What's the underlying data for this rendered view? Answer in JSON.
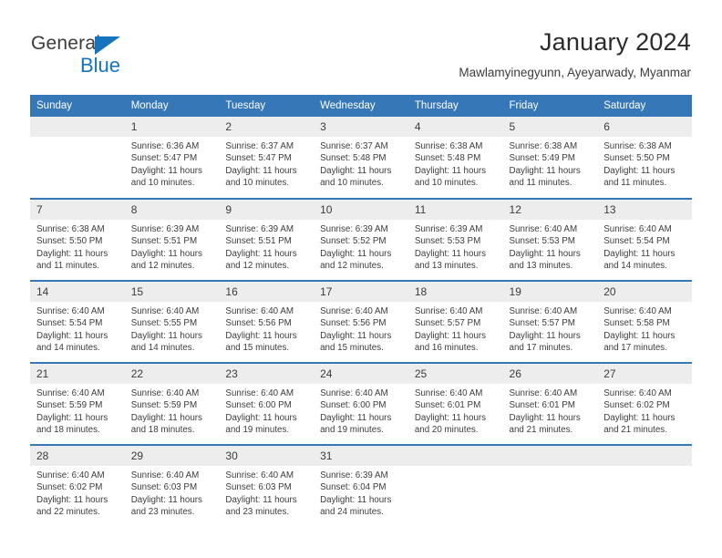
{
  "brand": {
    "name_part1": "General",
    "name_part2": "Blue",
    "triangle_icon": "blue-triangle-logo-mark",
    "accent_color": "#1574bb"
  },
  "header": {
    "title": "January 2024",
    "subtitle": "Mawlamyinegyunn, Ayeyarwady, Myanmar"
  },
  "theme": {
    "header_bar_color": "#3577b7",
    "daynum_band_color": "#ededed",
    "text_color": "#3c3c3c",
    "cell_background": "#ffffff"
  },
  "weekdays": [
    "Sunday",
    "Monday",
    "Tuesday",
    "Wednesday",
    "Thursday",
    "Friday",
    "Saturday"
  ],
  "weeks": [
    [
      {
        "day": "",
        "empty": true,
        "sunrise": "",
        "sunset": "",
        "daylight1": "",
        "daylight2": ""
      },
      {
        "day": "1",
        "sunrise": "Sunrise: 6:36 AM",
        "sunset": "Sunset: 5:47 PM",
        "daylight1": "Daylight: 11 hours",
        "daylight2": "and 10 minutes."
      },
      {
        "day": "2",
        "sunrise": "Sunrise: 6:37 AM",
        "sunset": "Sunset: 5:47 PM",
        "daylight1": "Daylight: 11 hours",
        "daylight2": "and 10 minutes."
      },
      {
        "day": "3",
        "sunrise": "Sunrise: 6:37 AM",
        "sunset": "Sunset: 5:48 PM",
        "daylight1": "Daylight: 11 hours",
        "daylight2": "and 10 minutes."
      },
      {
        "day": "4",
        "sunrise": "Sunrise: 6:38 AM",
        "sunset": "Sunset: 5:48 PM",
        "daylight1": "Daylight: 11 hours",
        "daylight2": "and 10 minutes."
      },
      {
        "day": "5",
        "sunrise": "Sunrise: 6:38 AM",
        "sunset": "Sunset: 5:49 PM",
        "daylight1": "Daylight: 11 hours",
        "daylight2": "and 11 minutes."
      },
      {
        "day": "6",
        "sunrise": "Sunrise: 6:38 AM",
        "sunset": "Sunset: 5:50 PM",
        "daylight1": "Daylight: 11 hours",
        "daylight2": "and 11 minutes."
      }
    ],
    [
      {
        "day": "7",
        "sunrise": "Sunrise: 6:38 AM",
        "sunset": "Sunset: 5:50 PM",
        "daylight1": "Daylight: 11 hours",
        "daylight2": "and 11 minutes."
      },
      {
        "day": "8",
        "sunrise": "Sunrise: 6:39 AM",
        "sunset": "Sunset: 5:51 PM",
        "daylight1": "Daylight: 11 hours",
        "daylight2": "and 12 minutes."
      },
      {
        "day": "9",
        "sunrise": "Sunrise: 6:39 AM",
        "sunset": "Sunset: 5:51 PM",
        "daylight1": "Daylight: 11 hours",
        "daylight2": "and 12 minutes."
      },
      {
        "day": "10",
        "sunrise": "Sunrise: 6:39 AM",
        "sunset": "Sunset: 5:52 PM",
        "daylight1": "Daylight: 11 hours",
        "daylight2": "and 12 minutes."
      },
      {
        "day": "11",
        "sunrise": "Sunrise: 6:39 AM",
        "sunset": "Sunset: 5:53 PM",
        "daylight1": "Daylight: 11 hours",
        "daylight2": "and 13 minutes."
      },
      {
        "day": "12",
        "sunrise": "Sunrise: 6:40 AM",
        "sunset": "Sunset: 5:53 PM",
        "daylight1": "Daylight: 11 hours",
        "daylight2": "and 13 minutes."
      },
      {
        "day": "13",
        "sunrise": "Sunrise: 6:40 AM",
        "sunset": "Sunset: 5:54 PM",
        "daylight1": "Daylight: 11 hours",
        "daylight2": "and 14 minutes."
      }
    ],
    [
      {
        "day": "14",
        "sunrise": "Sunrise: 6:40 AM",
        "sunset": "Sunset: 5:54 PM",
        "daylight1": "Daylight: 11 hours",
        "daylight2": "and 14 minutes."
      },
      {
        "day": "15",
        "sunrise": "Sunrise: 6:40 AM",
        "sunset": "Sunset: 5:55 PM",
        "daylight1": "Daylight: 11 hours",
        "daylight2": "and 14 minutes."
      },
      {
        "day": "16",
        "sunrise": "Sunrise: 6:40 AM",
        "sunset": "Sunset: 5:56 PM",
        "daylight1": "Daylight: 11 hours",
        "daylight2": "and 15 minutes."
      },
      {
        "day": "17",
        "sunrise": "Sunrise: 6:40 AM",
        "sunset": "Sunset: 5:56 PM",
        "daylight1": "Daylight: 11 hours",
        "daylight2": "and 15 minutes."
      },
      {
        "day": "18",
        "sunrise": "Sunrise: 6:40 AM",
        "sunset": "Sunset: 5:57 PM",
        "daylight1": "Daylight: 11 hours",
        "daylight2": "and 16 minutes."
      },
      {
        "day": "19",
        "sunrise": "Sunrise: 6:40 AM",
        "sunset": "Sunset: 5:57 PM",
        "daylight1": "Daylight: 11 hours",
        "daylight2": "and 17 minutes."
      },
      {
        "day": "20",
        "sunrise": "Sunrise: 6:40 AM",
        "sunset": "Sunset: 5:58 PM",
        "daylight1": "Daylight: 11 hours",
        "daylight2": "and 17 minutes."
      }
    ],
    [
      {
        "day": "21",
        "sunrise": "Sunrise: 6:40 AM",
        "sunset": "Sunset: 5:59 PM",
        "daylight1": "Daylight: 11 hours",
        "daylight2": "and 18 minutes."
      },
      {
        "day": "22",
        "sunrise": "Sunrise: 6:40 AM",
        "sunset": "Sunset: 5:59 PM",
        "daylight1": "Daylight: 11 hours",
        "daylight2": "and 18 minutes."
      },
      {
        "day": "23",
        "sunrise": "Sunrise: 6:40 AM",
        "sunset": "Sunset: 6:00 PM",
        "daylight1": "Daylight: 11 hours",
        "daylight2": "and 19 minutes."
      },
      {
        "day": "24",
        "sunrise": "Sunrise: 6:40 AM",
        "sunset": "Sunset: 6:00 PM",
        "daylight1": "Daylight: 11 hours",
        "daylight2": "and 19 minutes."
      },
      {
        "day": "25",
        "sunrise": "Sunrise: 6:40 AM",
        "sunset": "Sunset: 6:01 PM",
        "daylight1": "Daylight: 11 hours",
        "daylight2": "and 20 minutes."
      },
      {
        "day": "26",
        "sunrise": "Sunrise: 6:40 AM",
        "sunset": "Sunset: 6:01 PM",
        "daylight1": "Daylight: 11 hours",
        "daylight2": "and 21 minutes."
      },
      {
        "day": "27",
        "sunrise": "Sunrise: 6:40 AM",
        "sunset": "Sunset: 6:02 PM",
        "daylight1": "Daylight: 11 hours",
        "daylight2": "and 21 minutes."
      }
    ],
    [
      {
        "day": "28",
        "sunrise": "Sunrise: 6:40 AM",
        "sunset": "Sunset: 6:02 PM",
        "daylight1": "Daylight: 11 hours",
        "daylight2": "and 22 minutes."
      },
      {
        "day": "29",
        "sunrise": "Sunrise: 6:40 AM",
        "sunset": "Sunset: 6:03 PM",
        "daylight1": "Daylight: 11 hours",
        "daylight2": "and 23 minutes."
      },
      {
        "day": "30",
        "sunrise": "Sunrise: 6:40 AM",
        "sunset": "Sunset: 6:03 PM",
        "daylight1": "Daylight: 11 hours",
        "daylight2": "and 23 minutes."
      },
      {
        "day": "31",
        "sunrise": "Sunrise: 6:39 AM",
        "sunset": "Sunset: 6:04 PM",
        "daylight1": "Daylight: 11 hours",
        "daylight2": "and 24 minutes."
      },
      {
        "day": "",
        "empty": true,
        "sunrise": "",
        "sunset": "",
        "daylight1": "",
        "daylight2": ""
      },
      {
        "day": "",
        "empty": true,
        "sunrise": "",
        "sunset": "",
        "daylight1": "",
        "daylight2": ""
      },
      {
        "day": "",
        "empty": true,
        "sunrise": "",
        "sunset": "",
        "daylight1": "",
        "daylight2": ""
      }
    ]
  ]
}
